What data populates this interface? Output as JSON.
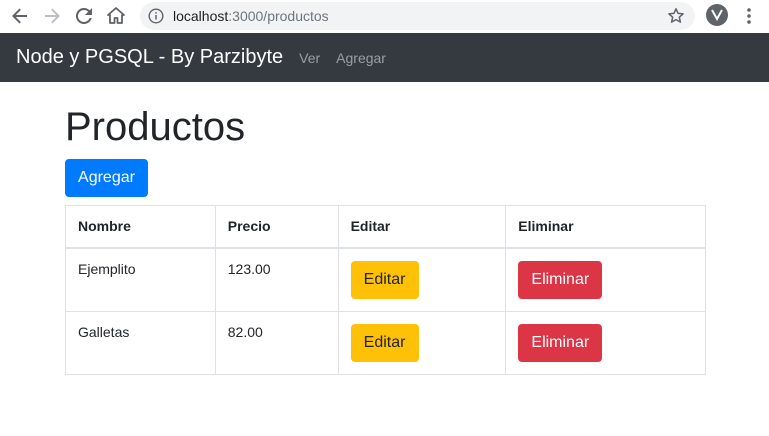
{
  "browser": {
    "url_host": "localhost",
    "url_rest": ":3000/productos"
  },
  "navbar": {
    "brand": "Node y PGSQL - By Parzibyte",
    "links": [
      "Ver",
      "Agregar"
    ]
  },
  "main": {
    "title": "Productos",
    "add_button": "Agregar",
    "table": {
      "headers": [
        "Nombre",
        "Precio",
        "Editar",
        "Eliminar"
      ],
      "rows": [
        {
          "nombre": "Ejemplito",
          "precio": "123.00",
          "edit_label": "Editar",
          "delete_label": "Eliminar"
        },
        {
          "nombre": "Galletas",
          "precio": "82.00",
          "edit_label": "Editar",
          "delete_label": "Eliminar"
        }
      ]
    }
  },
  "colors": {
    "navbar_bg": "#343a40",
    "primary": "#007bff",
    "warning": "#ffc107",
    "danger": "#dc3545"
  }
}
